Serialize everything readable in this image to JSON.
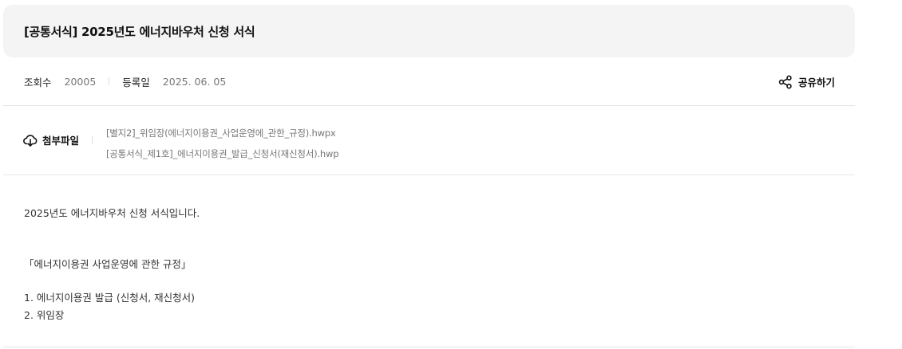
{
  "post": {
    "title": "[공통서식] 2025년도 에너지바우처 신청 서식"
  },
  "meta": {
    "views_label": "조회수",
    "views_value": "20005",
    "date_label": "등록일",
    "date_value": "2025. 06. 05",
    "share_label": "공유하기",
    "share_icon": "share-icon"
  },
  "attachments": {
    "label": "첨부파일",
    "icon": "cloud-download-icon",
    "files": [
      "[별지2]_위임장(에너지이용권_사업운영에_관한_규정).hwpx",
      "[공통서식_제1호]_에너지이용권_발급_신청서(재신청서).hwp"
    ]
  },
  "content": {
    "lines": [
      "2025년도 에너지바우처 신청 서식입니다.",
      "「에너지이용권 사업운영에 관한 규정」",
      "1. 에너지이용권 발급 (신청서, 재신청서)",
      "2. 위임장"
    ]
  }
}
